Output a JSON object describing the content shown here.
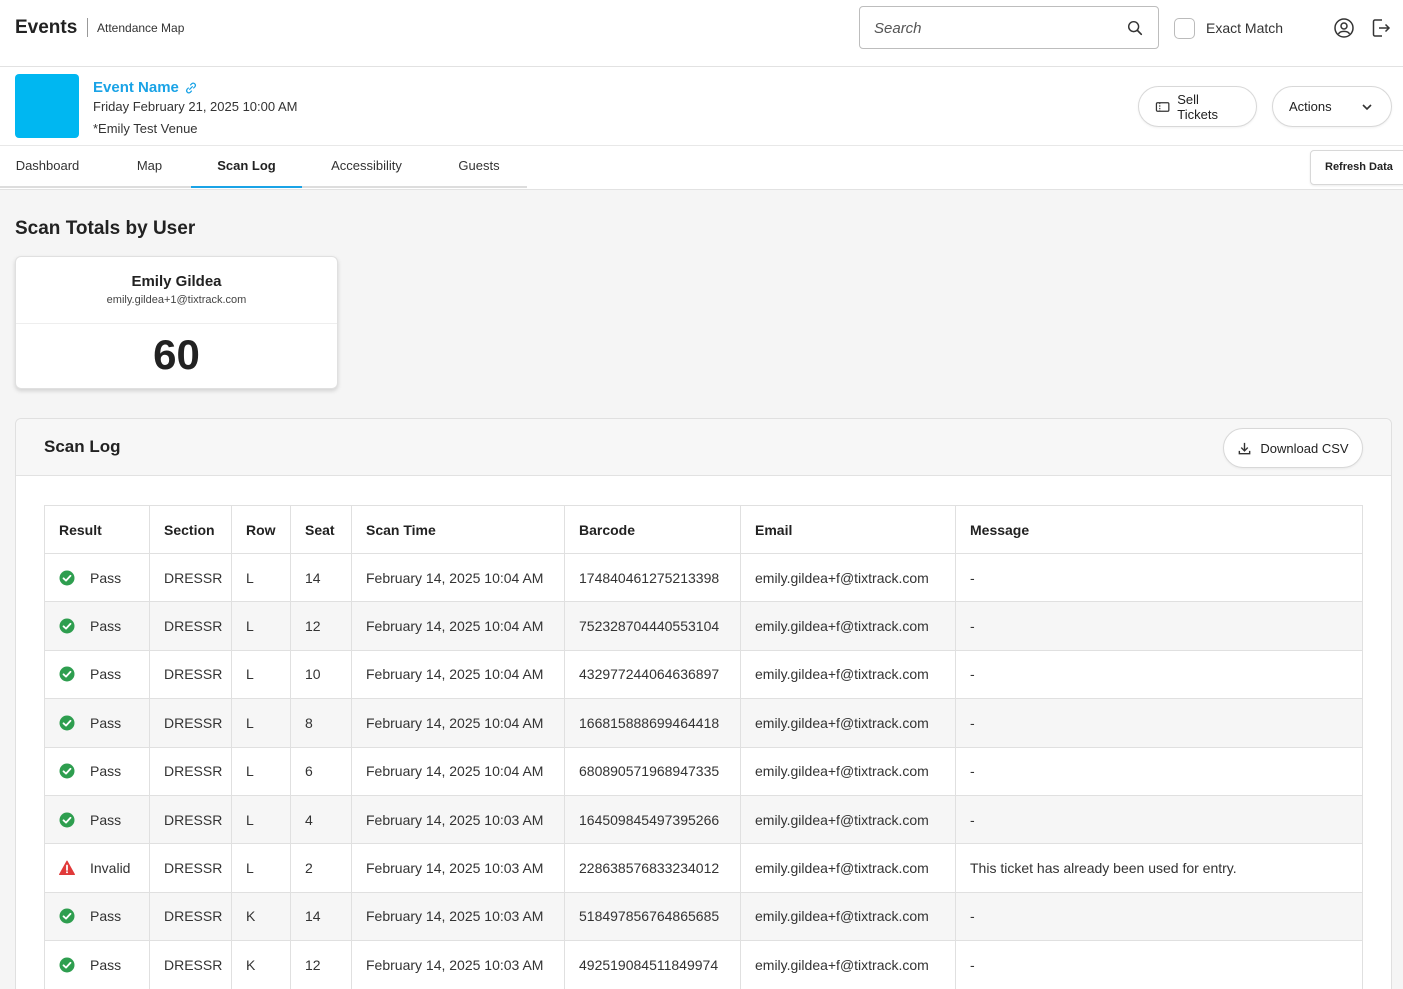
{
  "header": {
    "brand": "Events",
    "subtitle": "Attendance Map",
    "search_placeholder": "Search",
    "exact_match_label": "Exact Match"
  },
  "event": {
    "name": "Event Name",
    "date": "Friday February 21, 2025 10:00 AM",
    "venue": "*Emily Test Venue",
    "thumbnail_color": "#00b7f1",
    "sell_tickets_label": "Sell Tickets",
    "actions_label": "Actions"
  },
  "tabs": [
    {
      "label": "Dashboard",
      "active": false
    },
    {
      "label": "Map",
      "active": false
    },
    {
      "label": "Scan Log",
      "active": true
    },
    {
      "label": "Accessibility",
      "active": false
    },
    {
      "label": "Guests",
      "active": false
    }
  ],
  "refresh_label": "Refresh Data",
  "totals": {
    "title": "Scan Totals by User",
    "user_name": "Emily Gildea",
    "user_email": "emily.gildea+1@tixtrack.com",
    "count": "60"
  },
  "log": {
    "title": "Scan Log",
    "download_label": "Download CSV",
    "columns": [
      "Result",
      "Section",
      "Row",
      "Seat",
      "Scan Time",
      "Barcode",
      "Email",
      "Message"
    ],
    "rows": [
      {
        "result": "Pass",
        "status": "pass",
        "section": "DRESSR",
        "row": "L",
        "seat": "14",
        "time": "February 14, 2025 10:04 AM",
        "barcode": "174840461275213398",
        "email": "emily.gildea+f@tixtrack.com",
        "message": "-"
      },
      {
        "result": "Pass",
        "status": "pass",
        "section": "DRESSR",
        "row": "L",
        "seat": "12",
        "time": "February 14, 2025 10:04 AM",
        "barcode": "752328704440553104",
        "email": "emily.gildea+f@tixtrack.com",
        "message": "-"
      },
      {
        "result": "Pass",
        "status": "pass",
        "section": "DRESSR",
        "row": "L",
        "seat": "10",
        "time": "February 14, 2025 10:04 AM",
        "barcode": "432977244064636897",
        "email": "emily.gildea+f@tixtrack.com",
        "message": "-"
      },
      {
        "result": "Pass",
        "status": "pass",
        "section": "DRESSR",
        "row": "L",
        "seat": "8",
        "time": "February 14, 2025 10:04 AM",
        "barcode": "166815888699464418",
        "email": "emily.gildea+f@tixtrack.com",
        "message": "-"
      },
      {
        "result": "Pass",
        "status": "pass",
        "section": "DRESSR",
        "row": "L",
        "seat": "6",
        "time": "February 14, 2025 10:04 AM",
        "barcode": "680890571968947335",
        "email": "emily.gildea+f@tixtrack.com",
        "message": "-"
      },
      {
        "result": "Pass",
        "status": "pass",
        "section": "DRESSR",
        "row": "L",
        "seat": "4",
        "time": "February 14, 2025 10:03 AM",
        "barcode": "164509845497395266",
        "email": "emily.gildea+f@tixtrack.com",
        "message": "-"
      },
      {
        "result": "Invalid",
        "status": "invalid",
        "section": "DRESSR",
        "row": "L",
        "seat": "2",
        "time": "February 14, 2025 10:03 AM",
        "barcode": "228638576833234012",
        "email": "emily.gildea+f@tixtrack.com",
        "message": "This ticket has already been used for entry."
      },
      {
        "result": "Pass",
        "status": "pass",
        "section": "DRESSR",
        "row": "K",
        "seat": "14",
        "time": "February 14, 2025 10:03 AM",
        "barcode": "518497856764865685",
        "email": "emily.gildea+f@tixtrack.com",
        "message": "-"
      },
      {
        "result": "Pass",
        "status": "pass",
        "section": "DRESSR",
        "row": "K",
        "seat": "12",
        "time": "February 14, 2025 10:03 AM",
        "barcode": "492519084511849974",
        "email": "emily.gildea+f@tixtrack.com",
        "message": "-"
      }
    ]
  },
  "colors": {
    "accent": "#1aa3e6",
    "pass": "#2e9e4f",
    "invalid": "#e03a3a"
  }
}
